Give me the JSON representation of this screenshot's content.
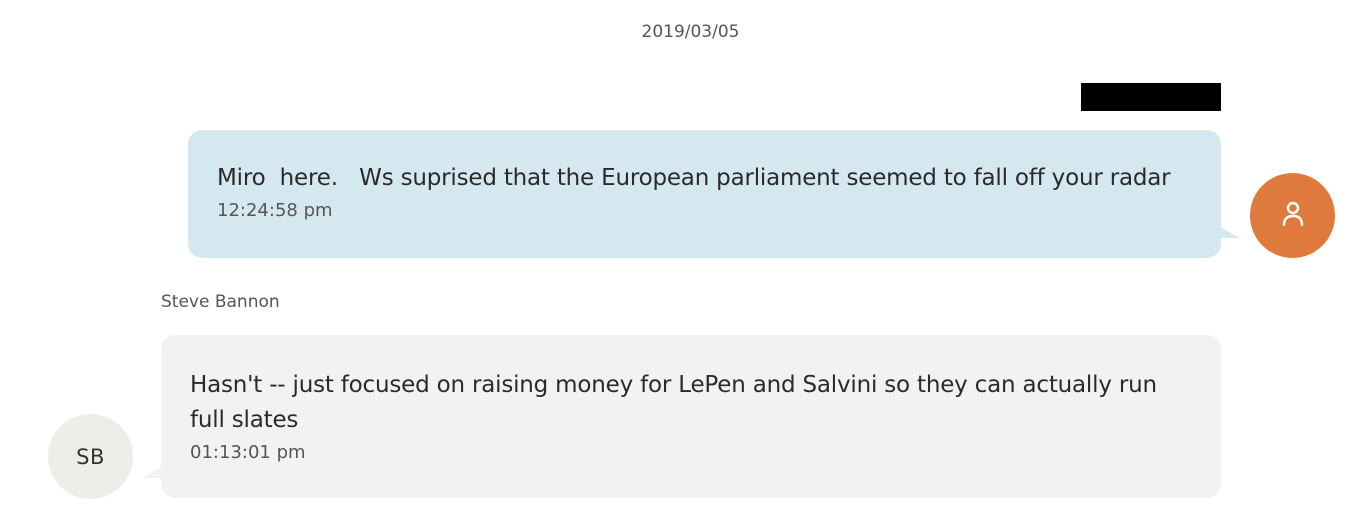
{
  "conversation": {
    "date": "2019/03/05",
    "messages": [
      {
        "direction": "outgoing",
        "text": "Miro  here.   Ws suprised that the European parliament seemed to fall off your radar",
        "time": "12:24:58 pm",
        "avatar_icon": "user-icon",
        "avatar_color": "#e07a3c",
        "bubble_color": "#d5e8f0"
      },
      {
        "direction": "incoming",
        "sender": "Steve Bannon",
        "avatar_initials": "SB",
        "text": "Hasn't -- just focused on raising money for LePen and Salvini so they can actually run full slates",
        "time": "01:13:01 pm",
        "bubble_color": "#f3f2f0"
      }
    ]
  }
}
